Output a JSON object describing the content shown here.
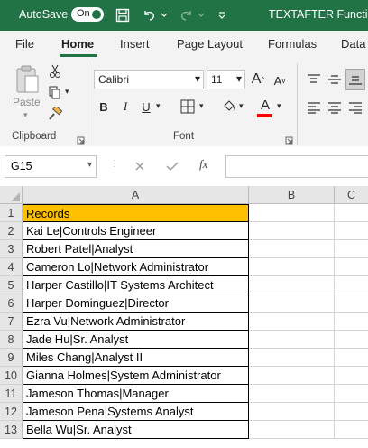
{
  "titlebar": {
    "autosave_label": "AutoSave",
    "toggle_state": "On",
    "document_title": "TEXTAFTER Function"
  },
  "tabs": [
    "File",
    "Home",
    "Insert",
    "Page Layout",
    "Formulas",
    "Data"
  ],
  "active_tab": "Home",
  "ribbon": {
    "clipboard": {
      "paste_label": "Paste",
      "group_label": "Clipboard"
    },
    "font": {
      "font_name": "Calibri",
      "font_size": "11",
      "group_label": "Font"
    },
    "colors": {
      "accent": "#217346",
      "font_color_bar": "#ff0000",
      "highlight_fill": "#ffc000"
    }
  },
  "formula_bar": {
    "name_box": "G15",
    "fx_label": "fx",
    "formula": ""
  },
  "grid": {
    "columns": [
      "A",
      "B",
      "C"
    ],
    "rows": [
      {
        "n": "1",
        "a": "Records"
      },
      {
        "n": "2",
        "a": "Kai Le|Controls Engineer"
      },
      {
        "n": "3",
        "a": "Robert Patel|Analyst"
      },
      {
        "n": "4",
        "a": "Cameron Lo|Network Administrator"
      },
      {
        "n": "5",
        "a": "Harper Castillo|IT Systems Architect"
      },
      {
        "n": "6",
        "a": "Harper Dominguez|Director"
      },
      {
        "n": "7",
        "a": "Ezra Vu|Network Administrator"
      },
      {
        "n": "8",
        "a": "Jade Hu|Sr. Analyst"
      },
      {
        "n": "9",
        "a": "Miles Chang|Analyst II"
      },
      {
        "n": "10",
        "a": "Gianna Holmes|System Administrator"
      },
      {
        "n": "11",
        "a": "Jameson Thomas|Manager"
      },
      {
        "n": "12",
        "a": "Jameson Pena|Systems Analyst"
      },
      {
        "n": "13",
        "a": "Bella Wu|Sr. Analyst"
      }
    ]
  }
}
